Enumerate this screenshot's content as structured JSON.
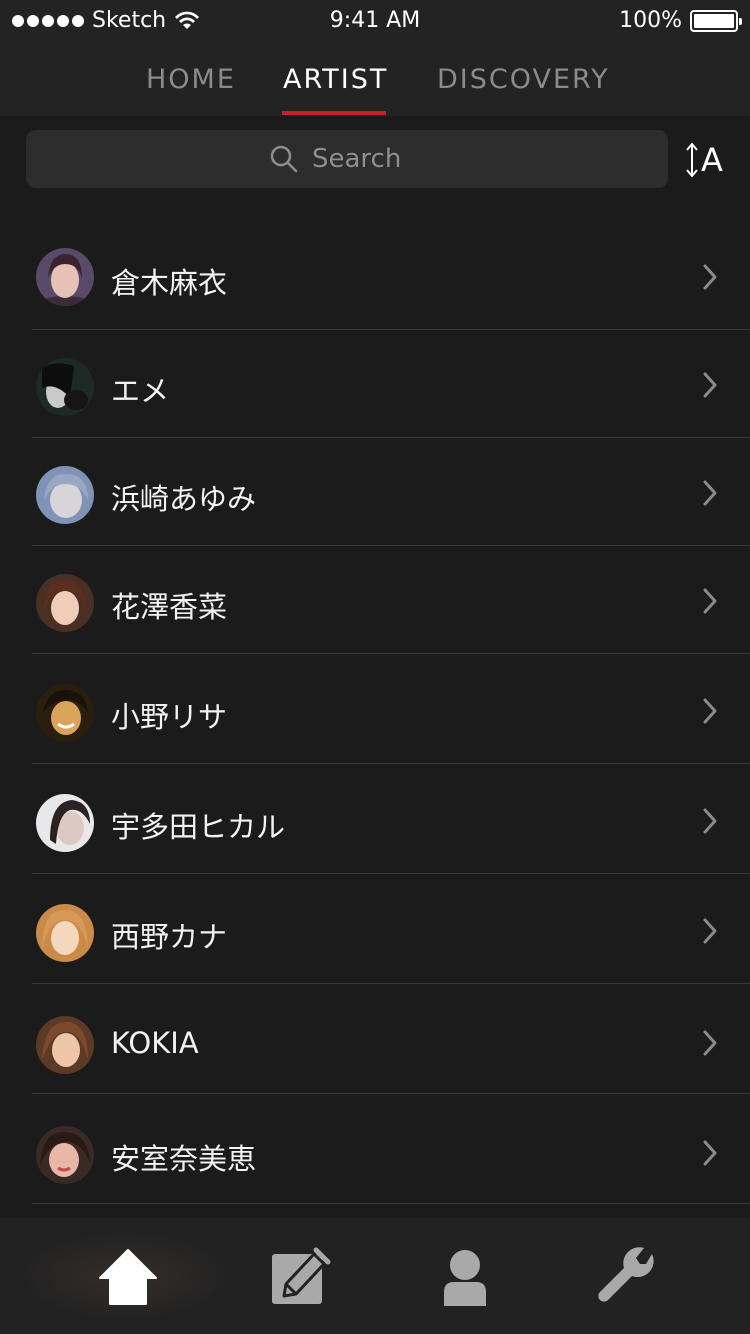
{
  "status_bar": {
    "carrier": "Sketch",
    "time": "9:41 AM",
    "battery": "100%",
    "battery_level": 1.0
  },
  "tabs": [
    {
      "label": "HOME",
      "active": false
    },
    {
      "label": "ARTIST",
      "active": true
    },
    {
      "label": "DISCOVERY",
      "active": false
    }
  ],
  "search": {
    "placeholder": "Search",
    "sort_label": "A"
  },
  "artists": [
    {
      "name": "倉木麻衣"
    },
    {
      "name": "エメ"
    },
    {
      "name": "浜崎あゆみ"
    },
    {
      "name": "花澤香菜"
    },
    {
      "name": "小野リサ"
    },
    {
      "name": "宇多田ヒカル"
    },
    {
      "name": "西野カナ"
    },
    {
      "name": "KOKIA"
    },
    {
      "name": "安室奈美恵"
    }
  ],
  "tab_bar": {
    "items": [
      {
        "icon": "home-icon",
        "active": true
      },
      {
        "icon": "compose-icon",
        "active": false
      },
      {
        "icon": "profile-icon",
        "active": false
      },
      {
        "icon": "wrench-icon",
        "active": false
      }
    ]
  },
  "colors": {
    "accent": "#c8202b",
    "background": "#1b1b1b",
    "bar": "#232323"
  }
}
